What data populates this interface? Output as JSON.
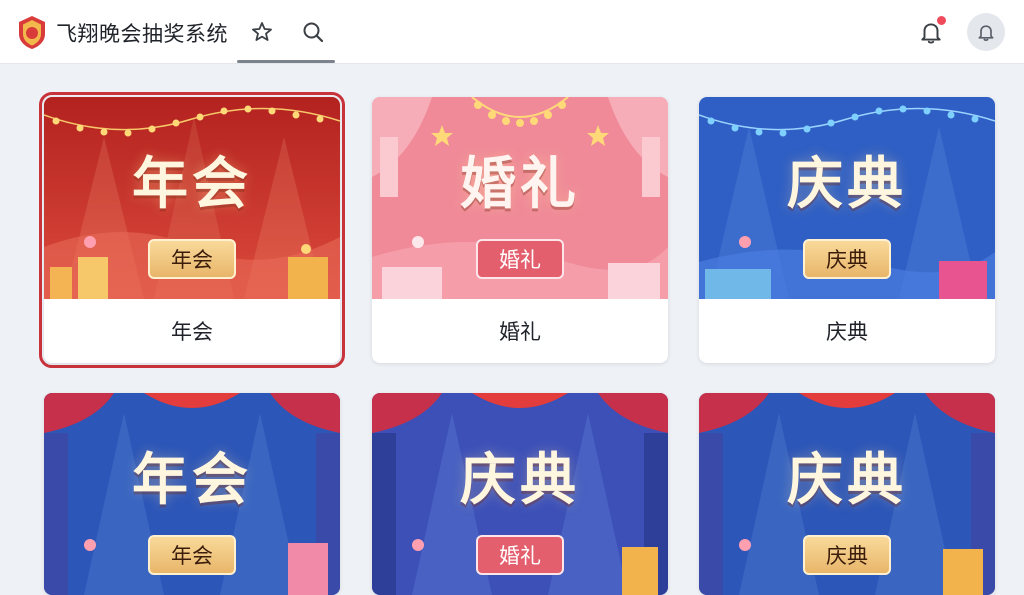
{
  "header": {
    "app_title": "飞翔晚会抽奖系统",
    "icons": [
      "logo-icon",
      "star-icon",
      "search-icon",
      "bell-icon",
      "avatar-bell-icon"
    ],
    "notification_dot_color": "#f04b5a"
  },
  "cards": [
    {
      "title": "年会",
      "tag": "年会",
      "label": "年会",
      "theme": "red",
      "selected": true
    },
    {
      "title": "婚礼",
      "tag": "婚礼",
      "label": "婚礼",
      "theme": "pink",
      "selected": false
    },
    {
      "title": "庆典",
      "tag": "庆典",
      "label": "庆典",
      "theme": "blue",
      "selected": false
    },
    {
      "title": "年会",
      "tag": "年会",
      "label": "",
      "theme": "blue-stage",
      "selected": false
    },
    {
      "title": "庆典",
      "tag": "婚礼",
      "label": "",
      "theme": "blue-stage",
      "selected": false
    },
    {
      "title": "庆典",
      "tag": "庆典",
      "label": "",
      "theme": "blue-stage",
      "selected": false
    }
  ],
  "colors": {
    "accent_selected": "#c8323a",
    "red_theme": "#c92d2f",
    "pink_theme": "#f08a98",
    "blue_theme": "#2f5fc4"
  }
}
